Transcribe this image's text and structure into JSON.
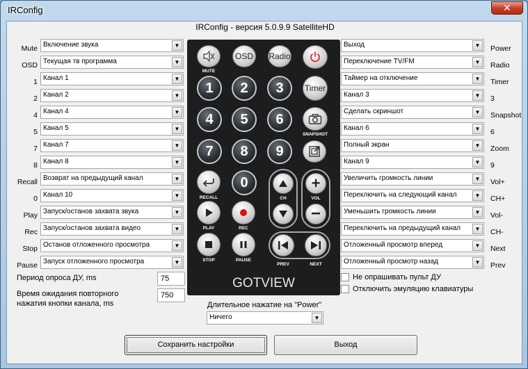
{
  "window": {
    "title": "IRConfig",
    "close": "✕"
  },
  "version": "IRConfig - версия 5.0.9.9  SatelliteHD",
  "left": [
    {
      "label": "Mute",
      "value": "Включение звука"
    },
    {
      "label": "OSD",
      "value": "Текущая тв программа"
    },
    {
      "label": "1",
      "value": "Канал 1"
    },
    {
      "label": "2",
      "value": "Канал 2"
    },
    {
      "label": "4",
      "value": "Канал 4"
    },
    {
      "label": "5",
      "value": "Канал 5"
    },
    {
      "label": "7",
      "value": "Канал 7"
    },
    {
      "label": "8",
      "value": "Канал 8"
    },
    {
      "label": "Recall",
      "value": "Возврат на предыдущий канал"
    },
    {
      "label": "0",
      "value": "Канал 10"
    },
    {
      "label": "Play",
      "value": "Запуск/останов захвата звука"
    },
    {
      "label": "Rec",
      "value": "Запуск/останов захвата видео"
    },
    {
      "label": "Stop",
      "value": "Останов отложенного просмотра"
    },
    {
      "label": "Pause",
      "value": "Запуск отложенного просмотра"
    }
  ],
  "right": [
    {
      "label": "Power",
      "value": "Выход"
    },
    {
      "label": "Radio",
      "value": "Переключение TV/FM"
    },
    {
      "label": "Timer",
      "value": "Таймер на отключение"
    },
    {
      "label": "3",
      "value": "Канал 3"
    },
    {
      "label": "Snapshot",
      "value": "Сделать скриншот"
    },
    {
      "label": "6",
      "value": "Канал 6"
    },
    {
      "label": "Zoom",
      "value": "Полный экран"
    },
    {
      "label": "9",
      "value": "Канал 9"
    },
    {
      "label": "Vol+",
      "value": "Увеличить громкость линии"
    },
    {
      "label": "CH+",
      "value": "Переключить на следующий канал"
    },
    {
      "label": "Vol-",
      "value": "Уменьшить громкость линии"
    },
    {
      "label": "CH-",
      "value": "Переключить на предыдущий канал"
    },
    {
      "label": "Next",
      "value": "Отложенный просмотр вперед"
    },
    {
      "label": "Prev",
      "value": "Отложенный просмотр назад"
    }
  ],
  "remote": {
    "osd": "OSD",
    "radio": "Radio",
    "timer": "Timer",
    "mute_label": "MUTE",
    "snapshot_label": "SNAPSHOT",
    "recall_label": "RECALL",
    "ch_label": "CH",
    "vol_label": "VOL",
    "play_label": "PLAY",
    "rec_label": "REC",
    "stop_label": "STOP",
    "pause_label": "PAUSE",
    "prev_label": "PREV",
    "next_label": "NEXT",
    "digits": [
      "1",
      "2",
      "3",
      "4",
      "5",
      "6",
      "7",
      "8",
      "9",
      "0"
    ],
    "brand": "GOTVIEW"
  },
  "poll": {
    "label": "Период опроса ДУ, ms",
    "value": "75"
  },
  "wait": {
    "label1": "Время ожидания повторного",
    "label2": "нажатия кнопки канала, ms",
    "value": "750"
  },
  "power_long": {
    "label": "Длительное нажатие на \"Power\"",
    "value": "Ничего"
  },
  "options": {
    "no_poll": "Не опрашивать пульт ДУ",
    "no_emulation": "Отключить эмуляцию клавиатуры"
  },
  "buttons": {
    "save": "Сохранить настройки",
    "exit": "Выход"
  }
}
